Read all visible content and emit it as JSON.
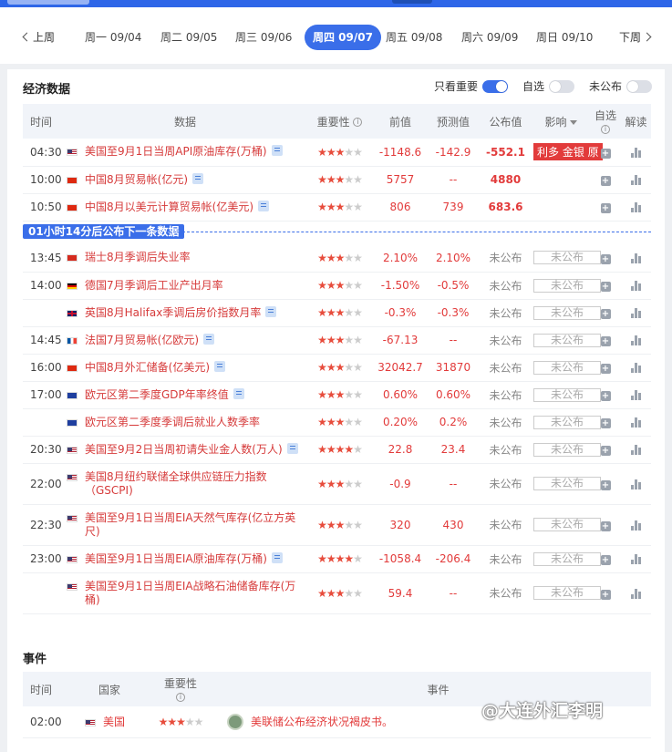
{
  "date_nav": {
    "prev": "上周",
    "next": "下周",
    "days": [
      {
        "label": "周一 09/04",
        "active": false
      },
      {
        "label": "周二 09/05",
        "active": false
      },
      {
        "label": "周三 09/06",
        "active": false
      },
      {
        "label": "周四 09/07",
        "active": true
      },
      {
        "label": "周五 09/08",
        "active": false
      },
      {
        "label": "周六 09/09",
        "active": false
      },
      {
        "label": "周日 09/10",
        "active": false
      }
    ]
  },
  "econ": {
    "title": "经济数据",
    "toggles": [
      {
        "label": "只看重要",
        "on": true
      },
      {
        "label": "自选",
        "on": false
      },
      {
        "label": "未公布",
        "on": false
      }
    ],
    "headers": {
      "time": "时间",
      "data": "数据",
      "importance": "重要性",
      "prev": "前值",
      "forecast": "预测值",
      "actual": "公布值",
      "impact": "影响",
      "watch": "自选",
      "interp": "解读"
    },
    "countdown": "01小时14分后公布下一条数据",
    "pending_label": "未公布",
    "rows_before": [
      {
        "time": "04:30",
        "country": "us",
        "name": "美国至9月1日当周API原油库存(万桶)",
        "doc": true,
        "stars": 3,
        "prev": "-1148.6",
        "forecast": "-142.9",
        "actual": "-552.1",
        "impact": "利多 金银 原"
      },
      {
        "time": "10:00",
        "country": "cn",
        "name": "中国8月贸易帐(亿元)",
        "doc": true,
        "stars": 3,
        "prev": "5757",
        "forecast": "--",
        "actual": "4880",
        "impact": ""
      },
      {
        "time": "10:50",
        "country": "cn",
        "name": "中国8月以美元计算贸易帐(亿美元)",
        "doc": true,
        "stars": 3,
        "prev": "806",
        "forecast": "739",
        "actual": "683.6",
        "impact": ""
      }
    ],
    "rows_after": [
      {
        "time": "13:45",
        "country": "ch",
        "name": "瑞士8月季调后失业率",
        "doc": false,
        "stars": 3,
        "prev": "2.10%",
        "forecast": "2.10%",
        "actual": "未公布"
      },
      {
        "time": "14:00",
        "country": "de",
        "name": "德国7月季调后工业产出月率",
        "doc": false,
        "stars": 3,
        "prev": "-1.50%",
        "forecast": "-0.5%",
        "actual": "未公布"
      },
      {
        "time": "",
        "country": "gb",
        "name": "英国8月Halifax季调后房价指数月率",
        "doc": true,
        "stars": 3,
        "prev": "-0.3%",
        "forecast": "-0.3%",
        "actual": "未公布"
      },
      {
        "time": "14:45",
        "country": "fr",
        "name": "法国7月贸易帐(亿欧元)",
        "doc": true,
        "stars": 3,
        "prev": "-67.13",
        "forecast": "--",
        "actual": "未公布"
      },
      {
        "time": "16:00",
        "country": "cn",
        "name": "中国8月外汇储备(亿美元)",
        "doc": true,
        "stars": 3,
        "prev": "32042.7",
        "forecast": "31870",
        "actual": "未公布"
      },
      {
        "time": "17:00",
        "country": "eu",
        "name": "欧元区第二季度GDP年率终值",
        "doc": true,
        "stars": 3,
        "prev": "0.60%",
        "forecast": "0.60%",
        "actual": "未公布"
      },
      {
        "time": "",
        "country": "eu",
        "name": "欧元区第二季度季调后就业人数季率",
        "doc": false,
        "stars": 3,
        "prev": "0.20%",
        "forecast": "0.2%",
        "actual": "未公布"
      },
      {
        "time": "20:30",
        "country": "us",
        "name": "美国至9月2日当周初请失业金人数(万人)",
        "doc": true,
        "stars": 4,
        "prev": "22.8",
        "forecast": "23.4",
        "actual": "未公布"
      },
      {
        "time": "22:00",
        "country": "us",
        "name": "美国8月纽约联储全球供应链压力指数（GSCPI)",
        "doc": false,
        "stars": 3,
        "prev": "-0.9",
        "forecast": "--",
        "actual": "未公布"
      },
      {
        "time": "22:30",
        "country": "us",
        "name": "美国至9月1日当周EIA天然气库存(亿立方英尺)",
        "doc": false,
        "stars": 3,
        "prev": "320",
        "forecast": "430",
        "actual": "未公布"
      },
      {
        "time": "23:00",
        "country": "us",
        "name": "美国至9月1日当周EIA原油库存(万桶)",
        "doc": true,
        "stars": 4,
        "prev": "-1058.4",
        "forecast": "-206.4",
        "actual": "未公布"
      },
      {
        "time": "",
        "country": "us",
        "name": "美国至9月1日当周EIA战略石油储备库存(万桶)",
        "doc": false,
        "stars": 3,
        "prev": "59.4",
        "forecast": "--",
        "actual": "未公布"
      }
    ]
  },
  "events": {
    "title": "事件",
    "headers": {
      "time": "时间",
      "country": "国家",
      "importance": "重要性",
      "event": "事件"
    },
    "rows": [
      {
        "time": "02:00",
        "country": "us",
        "country_name": "美国",
        "stars": 3,
        "event": "美联储公布经济状况褐皮书。"
      }
    ]
  },
  "watermark": "@大连外汇李明",
  "colors": {
    "accent": "#3a6ee9",
    "red": "#e23b3b"
  }
}
